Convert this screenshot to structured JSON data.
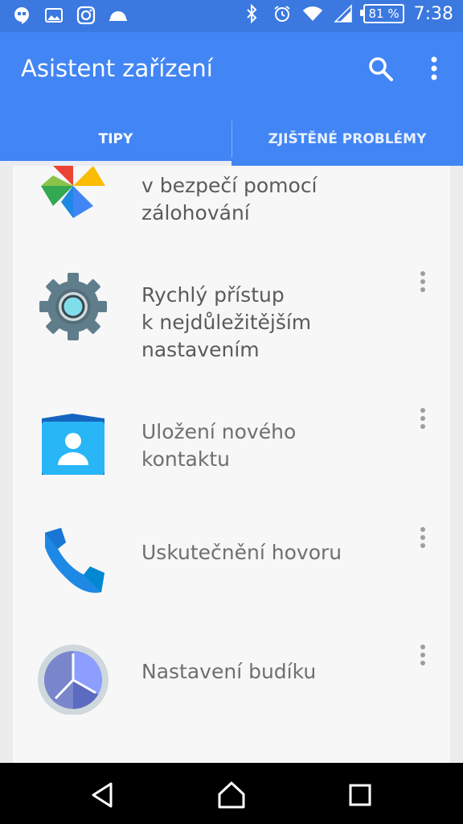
{
  "status_bar": {
    "battery": "81 %",
    "time": "7:38",
    "left_icons": [
      "hangouts-icon",
      "gallery-icon",
      "instagram-icon",
      "cloud-icon"
    ],
    "right_icons": [
      "bluetooth-icon",
      "alarm-icon",
      "wifi-icon",
      "cell-signal-icon",
      "battery-icon"
    ]
  },
  "app_bar": {
    "title": "Asistent zařízení",
    "search_icon": "search-icon",
    "overflow_icon": "more-vert-icon"
  },
  "tabs": [
    {
      "label": "TIPY",
      "selected": true
    },
    {
      "label": "ZJIŠTĚNÉ PROBLÉMY",
      "selected": false
    }
  ],
  "tips": [
    {
      "title": "v bezpečí pomocí\nzálohování",
      "icon": "photos-pinwheel-icon",
      "emphasis": "dark"
    },
    {
      "title": "Rychlý přístup\nk nejdůležitějším\nnastavením",
      "icon": "settings-gear-icon",
      "emphasis": "dark"
    },
    {
      "title": "Uložení nového\nkontaktu",
      "icon": "contacts-icon",
      "emphasis": "light"
    },
    {
      "title": "Uskutečnění hovoru",
      "icon": "phone-icon",
      "emphasis": "light"
    },
    {
      "title": "Nastavení budíku",
      "icon": "clock-icon",
      "emphasis": "light"
    }
  ],
  "colors": {
    "status_bar": "#3b78e0",
    "app_bar": "#4285f4",
    "card": "#f7f7f7",
    "background": "#ececec"
  },
  "nav_bar": {
    "buttons": [
      "back-icon",
      "home-icon",
      "recents-icon"
    ]
  }
}
